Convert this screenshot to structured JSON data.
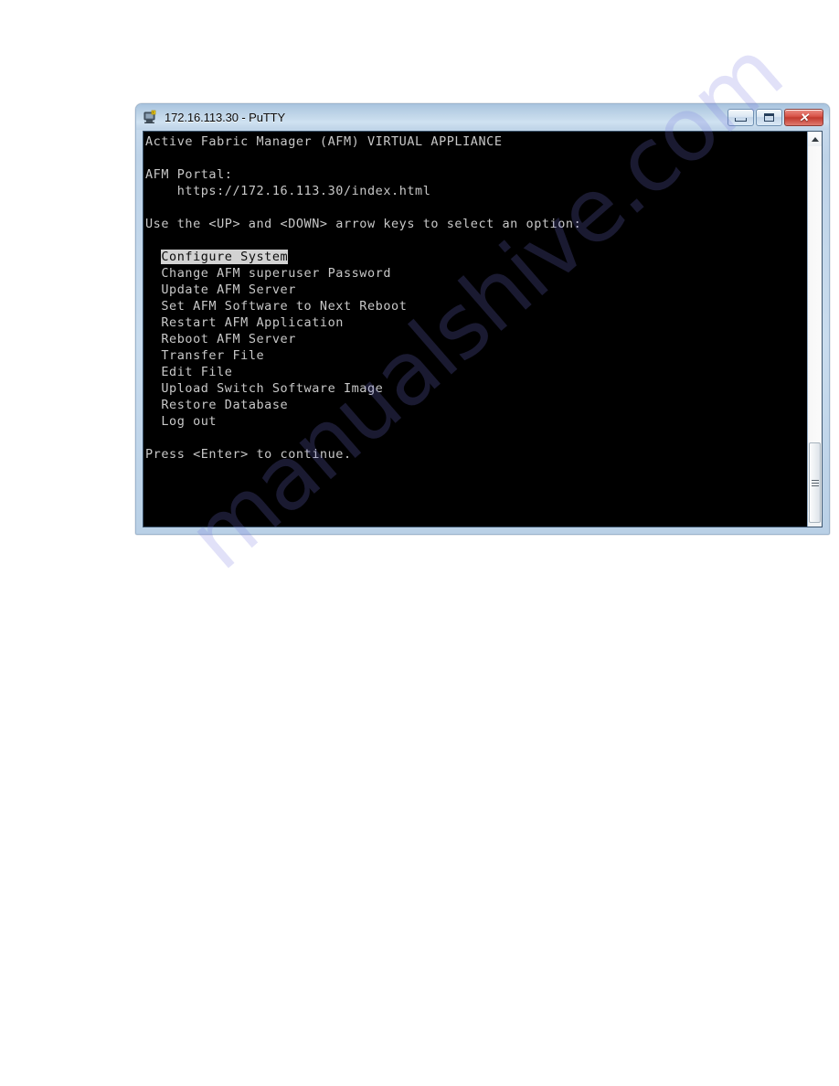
{
  "window": {
    "title": "172.16.113.30 - PuTTY",
    "icon": "putty-terminal-icon",
    "buttons": {
      "minimize": "–",
      "maximize": "□",
      "close": "✕"
    }
  },
  "terminal": {
    "background_color": "#000000",
    "foreground_color": "#c8c8c8",
    "highlight_background_color": "#d2d2d2",
    "highlight_foreground_color": "#0b0b0b",
    "lines": [
      "Active Fabric Manager (AFM) VIRTUAL APPLIANCE",
      "",
      "AFM Portal:",
      "    https://172.16.113.30/index.html",
      "",
      "Use the <UP> and <DOWN> arrow keys to select an option:",
      ""
    ],
    "heading": "Active Fabric Manager (AFM) VIRTUAL APPLIANCE",
    "portal_label": "AFM Portal:",
    "portal_url": "https://172.16.113.30/index.html",
    "instruction": "Use the <UP> and <DOWN> arrow keys to select an option:",
    "menu": {
      "selected_index": 0,
      "items": [
        "Configure System",
        "Change AFM superuser Password",
        "Update AFM Server",
        "Set AFM Software to Next Reboot",
        "Restart AFM Application",
        "Reboot AFM Server",
        "Transfer File",
        "Edit File",
        "Upload Switch Software Image",
        "Restore Database",
        "Log out"
      ]
    },
    "prompt": "Press <Enter> to continue."
  },
  "scrollbar": {
    "up_arrow": "scroll-up-arrow",
    "down_arrow": "scroll-down-arrow",
    "thumb": "scroll-thumb"
  },
  "watermark": {
    "text": "manualshive.com",
    "color": "#7878e1"
  }
}
